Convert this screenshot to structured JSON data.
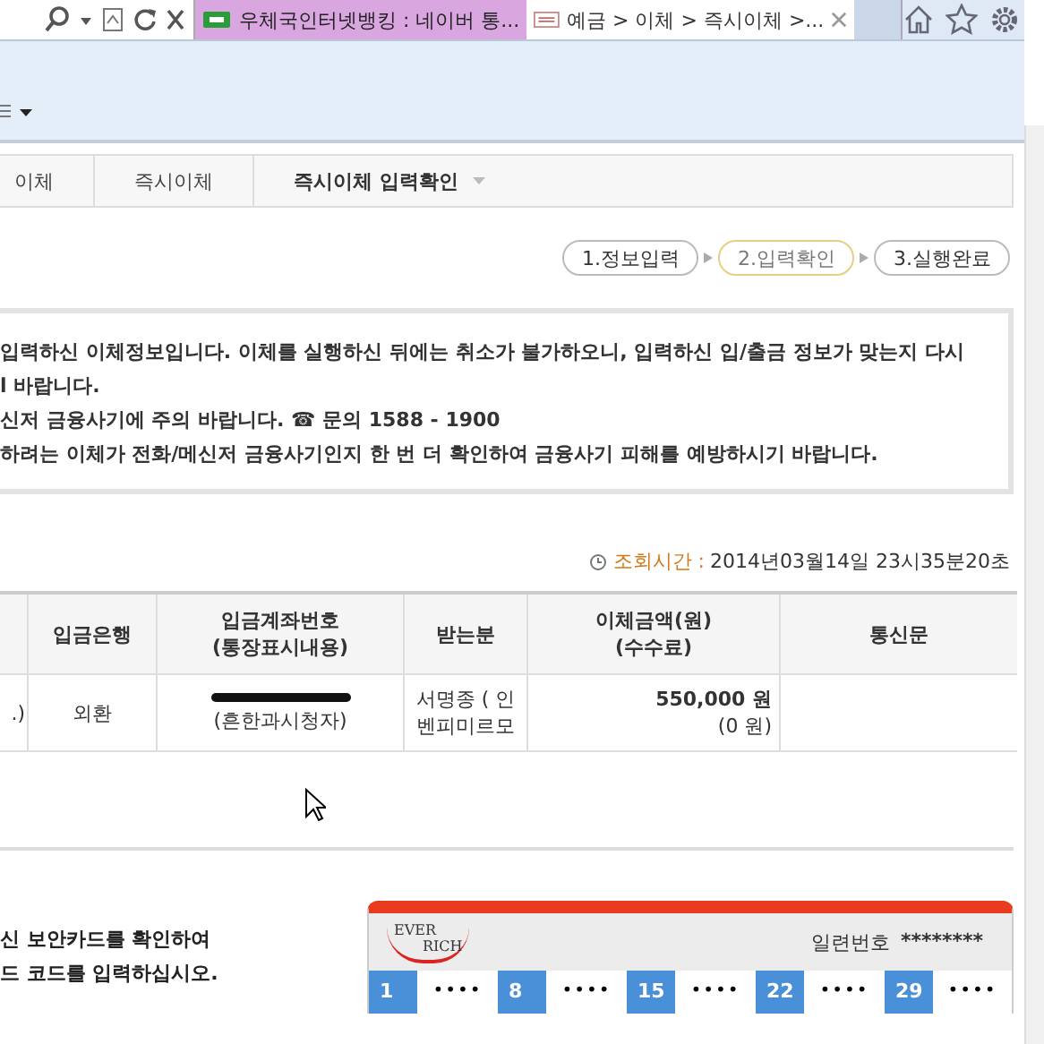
{
  "browser": {
    "tabs": [
      {
        "title": "우체국인터넷뱅킹 : 네이버 통...",
        "selected": false
      },
      {
        "title": "예금 > 이체 > 즉시이체 >...",
        "selected": true
      }
    ]
  },
  "breadcrumb": [
    {
      "label": "이체",
      "current": false
    },
    {
      "label": "즉시이체",
      "current": false
    },
    {
      "label": "즉시이체 입력확인",
      "current": true
    }
  ],
  "steps": [
    {
      "label": "1.정보입력",
      "selected": false
    },
    {
      "label": "2.입력확인",
      "selected": true
    },
    {
      "label": "3.실행완료",
      "selected": false
    }
  ],
  "notice": [
    "입력하신 이체정보입니다. 이체를 실행하신 뒤에는 취소가 불가하오니, 입력하신 입/출금 정보가 맞는지 다시",
    "l 바랍니다.",
    "신저 금융사기에 주의 바랍니다. ☎ 문의 1588 - 1900",
    "하려는 이체가 전화/메신저 금융사기인지 한 번 더 확인하여 금융사기 피해를 예방하시기 바랍니다."
  ],
  "query_time": {
    "label": "조회시간 :",
    "value": "2014년03월14일 23시35분20초"
  },
  "table": {
    "columns": [
      [],
      [
        "입금은행"
      ],
      [
        "입금계좌번호",
        "(통장표시내용)"
      ],
      [
        "받는분"
      ],
      [
        "이체금액(원)",
        "(수수료)"
      ],
      [
        "통신문"
      ]
    ],
    "rows": [
      {
        "column_1": ".)",
        "bank": "외환",
        "account_note": "(흔한과시청자)",
        "recipient": [
          "서명종 ( 인",
          "벤피미르모"
        ],
        "amount": "550,000 원",
        "fee": "(0 원)"
      }
    ]
  },
  "instructions": [
    "신 보안카드를 확인하여",
    "드 코드를 입력하십시오."
  ],
  "security_card": {
    "logo_top": "EVER",
    "logo_bottom": "RICH",
    "serial_label": "일련번호",
    "serial": "********",
    "cells": [
      {
        "number": "1",
        "code": "••••"
      },
      {
        "number": "8",
        "code": "••••"
      },
      {
        "number": "15",
        "code": "••••"
      },
      {
        "number": "22",
        "code": "••••"
      },
      {
        "number": "29",
        "code": "••••"
      }
    ]
  }
}
